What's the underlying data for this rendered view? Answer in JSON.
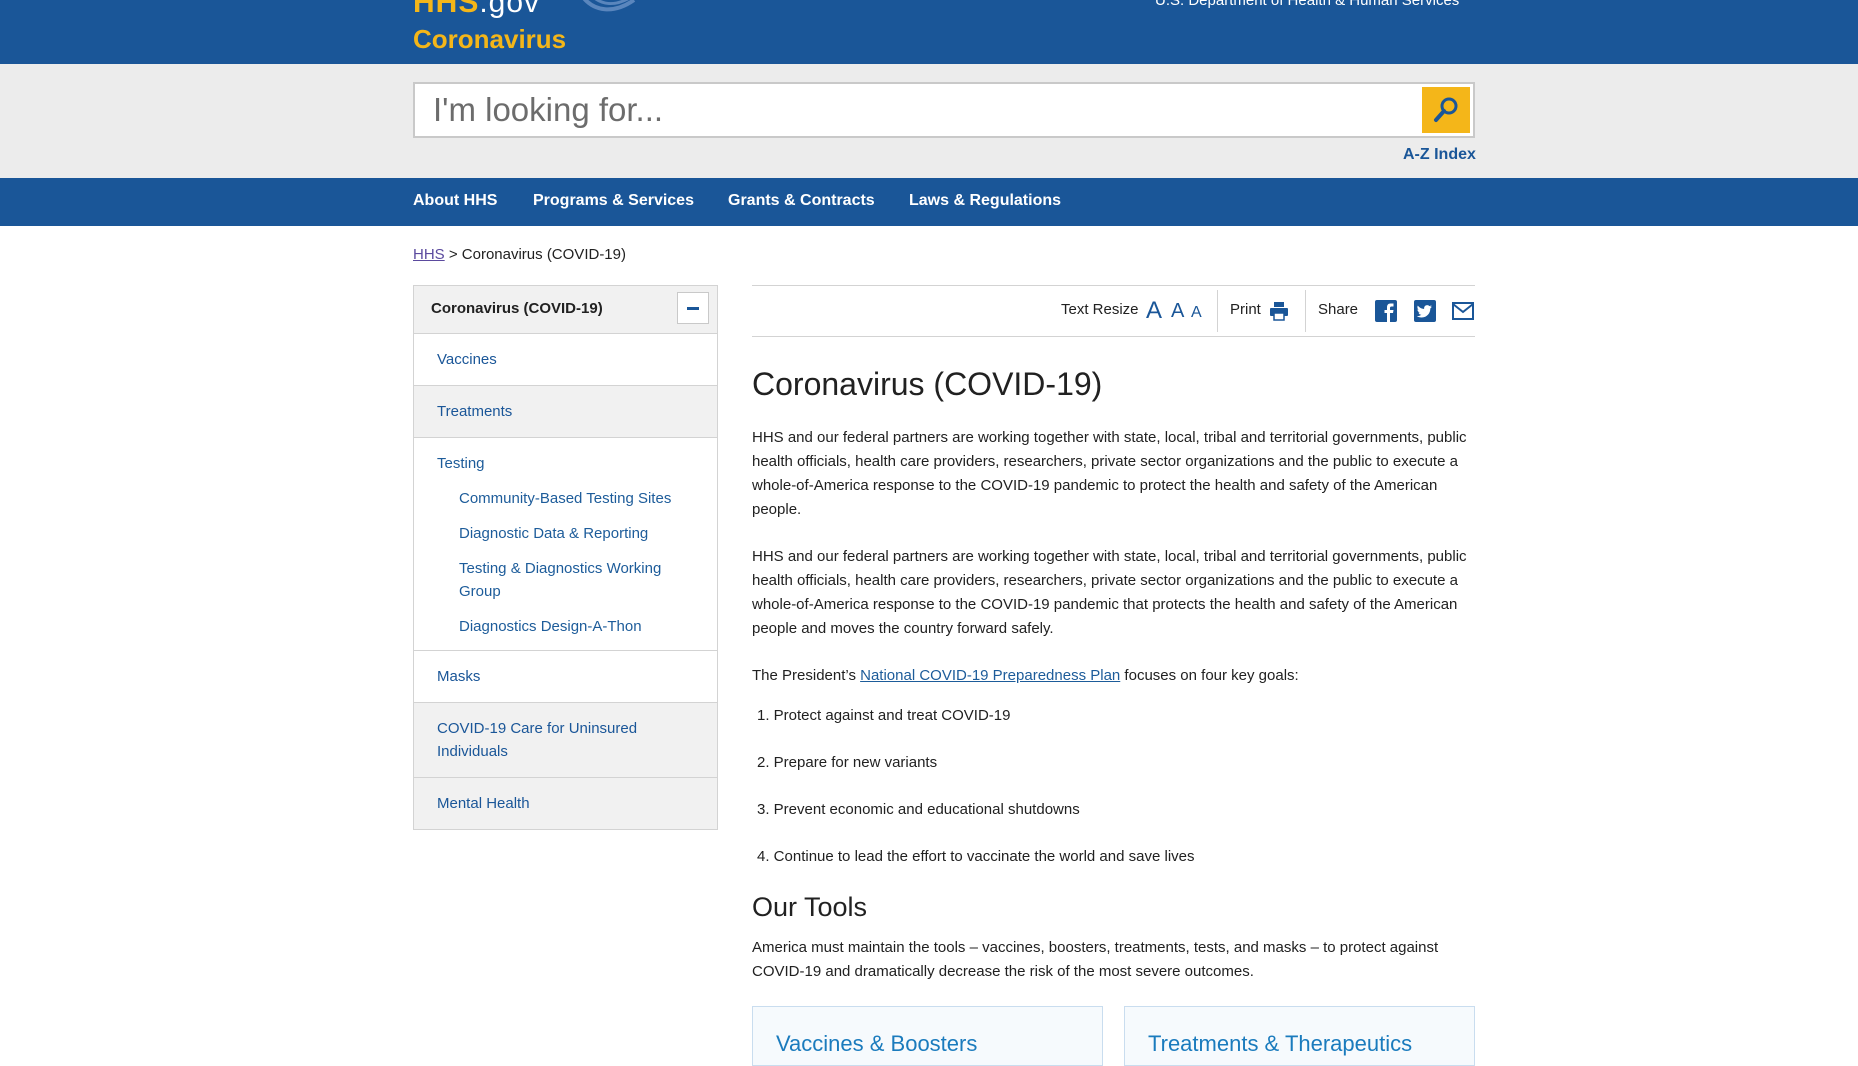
{
  "header": {
    "logo_text": "HHS",
    "logo_suffix": ".gov",
    "site_title": "Coronavirus",
    "dept_text": "U.S. Department of Health & Human Services"
  },
  "search": {
    "placeholder": "I'm looking for...",
    "az_label": "A-Z Index"
  },
  "nav": {
    "items": [
      "About HHS",
      "Programs & Services",
      "Grants & Contracts",
      "Laws & Regulations"
    ]
  },
  "breadcrumb": {
    "home": "HHS",
    "separator": ">",
    "current": "Coronavirus (COVID-19)"
  },
  "sidebar": {
    "heading": "Coronavirus (COVID-19)",
    "items": [
      {
        "label": "Vaccines"
      },
      {
        "label": "Treatments"
      },
      {
        "label": "Testing"
      },
      {
        "label": "Masks"
      },
      {
        "label": "COVID-19 Care for Uninsured Individuals"
      },
      {
        "label": "Mental Health"
      }
    ],
    "testing_sub": [
      "Community-Based Testing Sites",
      "Diagnostic Data & Reporting",
      "Testing & Diagnostics Working Group",
      "Diagnostics Design-A-Thon"
    ]
  },
  "toolbar": {
    "text_resize_label": "Text Resize",
    "resize_glyph": "A",
    "print_label": "Print",
    "share_label": "Share"
  },
  "content": {
    "title": "Coronavirus (COVID-19)",
    "para1": "HHS and our federal partners are working together with state, local, tribal and territorial governments, public health officials, health care providers, researchers, private sector organizations and the public to execute a whole-of-America response to the COVID-19 pandemic to protect the health and safety of the American people.",
    "para2": "HHS and our federal partners are working together with state, local, tribal and territorial governments, public health officials, health care providers, researchers, private sector organizations and the public to execute a whole-of-America response to the COVID-19 pandemic that protects the health and safety of the American people and moves the country forward safely.",
    "plan_prefix": "The President’s ",
    "plan_link": "National COVID-19 Preparedness Plan",
    "plan_suffix": " focuses on four key goals:",
    "goals": [
      "1. Protect against and treat COVID-19",
      "2. Prepare for new variants",
      "3. Prevent economic and educational shutdowns",
      "4. Continue to lead the effort to vaccinate the world and save lives"
    ],
    "tools_title": "Our Tools",
    "tools_text": "America must maintain the tools – vaccines, boosters, treatments, tests, and masks – to protect against COVID-19 and dramatically decrease the risk of the most severe outcomes."
  },
  "cards": [
    "Vaccines & Boosters",
    "Treatments & Therapeutics"
  ],
  "colors": {
    "brand_blue": "#1a5698",
    "accent_gold": "#f4b619",
    "link_blue": "#1d5c9a",
    "visited_purple": "#5b4a9e"
  }
}
